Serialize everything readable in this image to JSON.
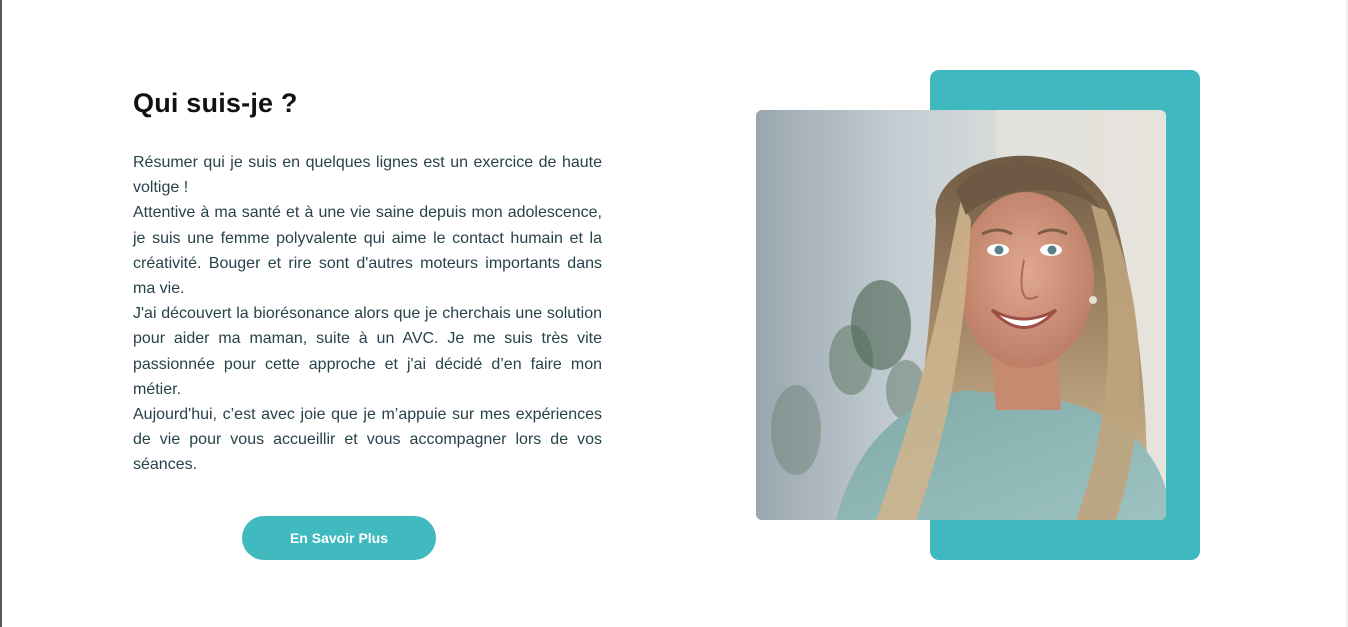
{
  "section": {
    "title": "Qui suis-je ?",
    "paragraphs": [
      "Résumer qui je suis en quelques lignes est un exercice de haute voltige !",
      "Attentive à ma santé et à une vie saine depuis mon adolescence, je suis une femme polyvalente qui aime le contact humain et la créativité. Bouger et rire sont d'autres moteurs importants dans ma vie.",
      "J'ai découvert la biorésonance alors que je cherchais une solution pour aider ma maman, suite à un AVC. Je me suis très vite passionnée pour cette approche et j'ai décidé d’en faire mon métier.",
      "Aujourd'hui, c’est avec joie que je m’appuie sur mes expériences de vie pour vous accueillir et vous accompagner lors de vos séances."
    ],
    "button_label": "En Savoir Plus"
  },
  "colors": {
    "accent": "#40b9bf",
    "heading": "#111111",
    "body_text": "#27424a"
  },
  "photo": {
    "subject": "portrait-photo"
  }
}
